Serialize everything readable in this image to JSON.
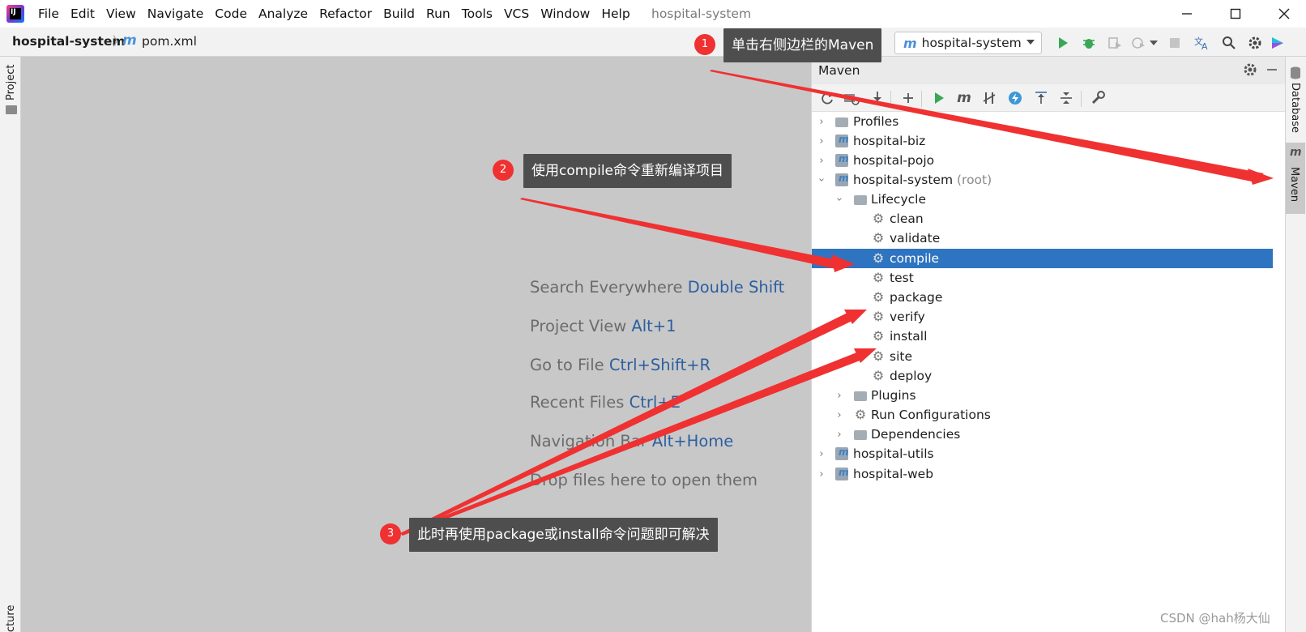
{
  "window": {
    "title": "hospital-system",
    "menu": [
      "File",
      "Edit",
      "View",
      "Navigate",
      "Code",
      "Analyze",
      "Refactor",
      "Build",
      "Run",
      "Tools",
      "VCS",
      "Window",
      "Help"
    ]
  },
  "navbar": {
    "project": "hospital-system",
    "separator": "〉",
    "file_icon": "m",
    "file": "pom.xml",
    "run_config": "hospital-system"
  },
  "left_strip": {
    "project_tab": "Project",
    "structure_tab": "Structure"
  },
  "editor": {
    "hints": [
      {
        "text": "Search Everywhere ",
        "key": "Double Shift"
      },
      {
        "text": "Project View ",
        "key": "Alt+1"
      },
      {
        "text": "Go to File ",
        "key": "Ctrl+Shift+R"
      },
      {
        "text": "Recent Files ",
        "key": "Ctrl+E"
      },
      {
        "text": "Navigation Bar ",
        "key": "Alt+Home"
      },
      {
        "text": "Drop files here to open them",
        "key": ""
      }
    ]
  },
  "maven": {
    "title": "Maven",
    "tree": [
      {
        "label": "Profiles",
        "extra": ""
      },
      {
        "label": "hospital-biz",
        "extra": ""
      },
      {
        "label": "hospital-pojo",
        "extra": ""
      },
      {
        "label": "hospital-system",
        "extra": "(root)"
      },
      {
        "label": "Lifecycle",
        "extra": ""
      },
      {
        "label": "clean",
        "extra": ""
      },
      {
        "label": "validate",
        "extra": ""
      },
      {
        "label": "compile",
        "extra": ""
      },
      {
        "label": "test",
        "extra": ""
      },
      {
        "label": "package",
        "extra": ""
      },
      {
        "label": "verify",
        "extra": ""
      },
      {
        "label": "install",
        "extra": ""
      },
      {
        "label": "site",
        "extra": ""
      },
      {
        "label": "deploy",
        "extra": ""
      },
      {
        "label": "Plugins",
        "extra": ""
      },
      {
        "label": "Run Configurations",
        "extra": ""
      },
      {
        "label": "Dependencies",
        "extra": ""
      },
      {
        "label": "hospital-utils",
        "extra": ""
      },
      {
        "label": "hospital-web",
        "extra": ""
      }
    ],
    "selected": "compile"
  },
  "right_strip": {
    "database_tab": "Database",
    "maven_tab": "Maven",
    "maven_icon": "m"
  },
  "callouts": [
    {
      "number": "1",
      "text": "单击右侧边栏的Maven"
    },
    {
      "number": "2",
      "text": "使用compile命令重新编译项目"
    },
    {
      "number": "3",
      "text": "此时再使用package或install命令问题即可解决"
    }
  ],
  "colors": {
    "selection": "#2f74c0",
    "callout_bg": "#4e4e4e",
    "badge": "#f03131",
    "arrow": "#f03131",
    "editor_bg": "#c8c8c8"
  },
  "watermark": "CSDN @hah杨大仙"
}
